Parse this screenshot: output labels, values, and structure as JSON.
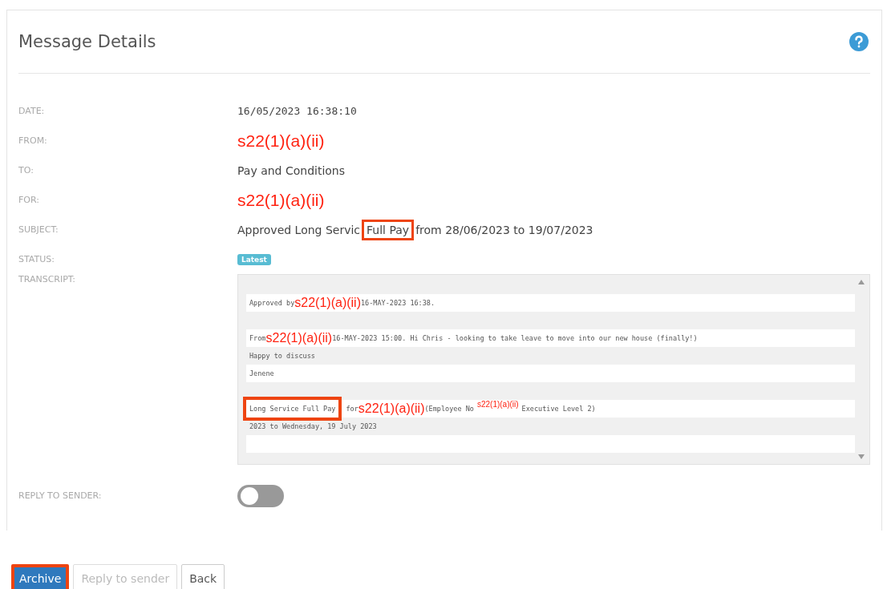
{
  "panel": {
    "title": "Message Details"
  },
  "fields": [
    {
      "label": "DATE:",
      "kind": "mono",
      "value": "16/05/2023 16:38:10"
    },
    {
      "label": "FROM:",
      "kind": "redaction",
      "value": "s22(1)(a)(ii)"
    },
    {
      "label": "TO:",
      "kind": "text",
      "value": "Pay and Conditions"
    },
    {
      "label": "FOR:",
      "kind": "redaction",
      "value": "s22(1)(a)(ii)"
    },
    {
      "label": "SUBJECT:",
      "kind": "text",
      "parts": [
        {
          "text": "Approved Long Servic",
          "highlighted": false
        },
        {
          "text": "Full Pay",
          "highlighted": true
        },
        {
          "text": "from 28/06/2023 to 19/07/2023",
          "highlighted": false
        }
      ]
    },
    {
      "label": "STATUS:",
      "kind": "badge",
      "value": "Latest"
    }
  ],
  "transcript": {
    "label": "TRANSCRIPT:",
    "lines": [
      {
        "shaded": false,
        "segments": [
          {
            "kind": "plain",
            "text": "Approved by "
          },
          {
            "kind": "redaction",
            "text": "s22(1)(a)(ii)"
          },
          {
            "kind": "plain",
            "text": "16-MAY-2023 16:38."
          }
        ]
      },
      {
        "shaded": false,
        "segments": [
          {
            "kind": "plain",
            "text": "From "
          },
          {
            "kind": "redaction",
            "text": "s22(1)(a)(ii)"
          },
          {
            "kind": "plain",
            "text": "16-MAY-2023 15:00. Hi Chris - looking to take leave to move into our new house (finally!)"
          }
        ]
      },
      {
        "shaded": true,
        "segments": [
          {
            "kind": "plain",
            "text": "Happy to discuss"
          }
        ]
      },
      {
        "shaded": false,
        "segments": [
          {
            "kind": "plain",
            "text": "Jenene"
          }
        ]
      },
      {
        "shaded": false,
        "segments": [
          {
            "kind": "highlight",
            "text": "Long Service Full Pay"
          },
          {
            "kind": "plain",
            "text": " for "
          },
          {
            "kind": "redaction",
            "text": "s22(1)(a)(ii)"
          },
          {
            "kind": "plain",
            "text": " (Employee No "
          },
          {
            "kind": "redaction_small",
            "text": "s22(1)(a)(ii)"
          },
          {
            "kind": "plain",
            "text": " Executive Level 2)"
          }
        ]
      },
      {
        "shaded": true,
        "segments": [
          {
            "kind": "plain",
            "text": "2023 to Wednesday, 19 July 2023"
          }
        ]
      },
      {
        "shaded": false
      }
    ]
  },
  "reply_toggle": {
    "label": "REPLY TO SENDER:",
    "on": false
  },
  "buttons": [
    {
      "label": "Archive",
      "kind": "primary",
      "disabled": false,
      "highlighted": true
    },
    {
      "label": "Reply to sender",
      "kind": "default",
      "disabled": true,
      "highlighted": false
    },
    {
      "label": "Back",
      "kind": "default",
      "disabled": false,
      "highlighted": false
    }
  ]
}
